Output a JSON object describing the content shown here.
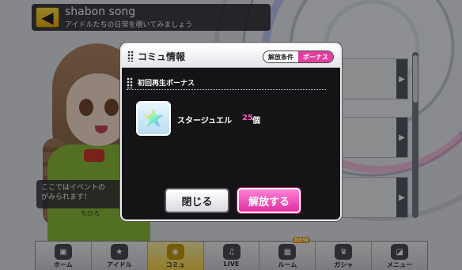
{
  "header": {
    "back_icon": "arrow-left-icon",
    "title": "shabon song",
    "subtitle": "アイドルたちの日常を覗いてみましょう"
  },
  "background": {
    "speech_text": "ここではイベントの\nがみられます！",
    "idol_tag": "ちひろ"
  },
  "modal": {
    "title": "コミュ情報",
    "tabs": [
      {
        "label": "解放条件",
        "active": false
      },
      {
        "label": "ボーナス",
        "active": true
      }
    ],
    "section_title": "初回再生ボーナス",
    "reward": {
      "icon": "star-jewel-icon",
      "name": "スタージュエル",
      "count": "25",
      "unit": "個"
    },
    "close_label": "閉じる",
    "unlock_label": "解放する"
  },
  "nav": {
    "items": [
      {
        "label": "ホーム",
        "icon": "home-speaker-icon",
        "active": false
      },
      {
        "label": "アイドル",
        "icon": "idol-star-icon",
        "active": false
      },
      {
        "label": "コミュ",
        "icon": "commu-icon",
        "active": true
      },
      {
        "label": "LIVE",
        "icon": "music-note-icon",
        "active": false
      },
      {
        "label": "ルーム",
        "icon": "room-cube-icon",
        "active": false,
        "badge": "NEW"
      },
      {
        "label": "ガシャ",
        "icon": "gacha-icon",
        "active": false
      },
      {
        "label": "メニュー",
        "icon": "menu-icon",
        "active": false
      }
    ]
  },
  "colors": {
    "accent_pink": "#e23ea0",
    "count_pink": "#ff55c8",
    "back_yellow": "#f2b60d"
  }
}
